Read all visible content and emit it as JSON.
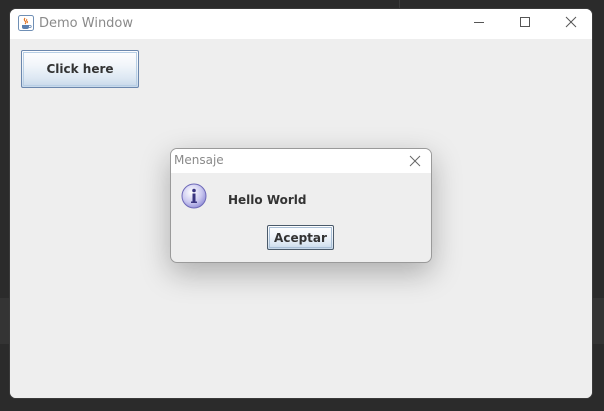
{
  "window": {
    "title": "Demo Window",
    "icon": "java-cup-icon",
    "controls": [
      "minimize-icon",
      "maximize-icon",
      "close-icon"
    ]
  },
  "main": {
    "button_label": "Click here"
  },
  "dialog": {
    "title": "Mensaje",
    "icon": "info-icon",
    "message": "Hello World",
    "ok_label": "Aceptar"
  },
  "colors": {
    "desktop": "#2b2b2b",
    "window_background": "#eeeeee",
    "titlebar": "#ffffff",
    "title_text": "#8a8a8a",
    "button_border": "#6b87ad"
  }
}
